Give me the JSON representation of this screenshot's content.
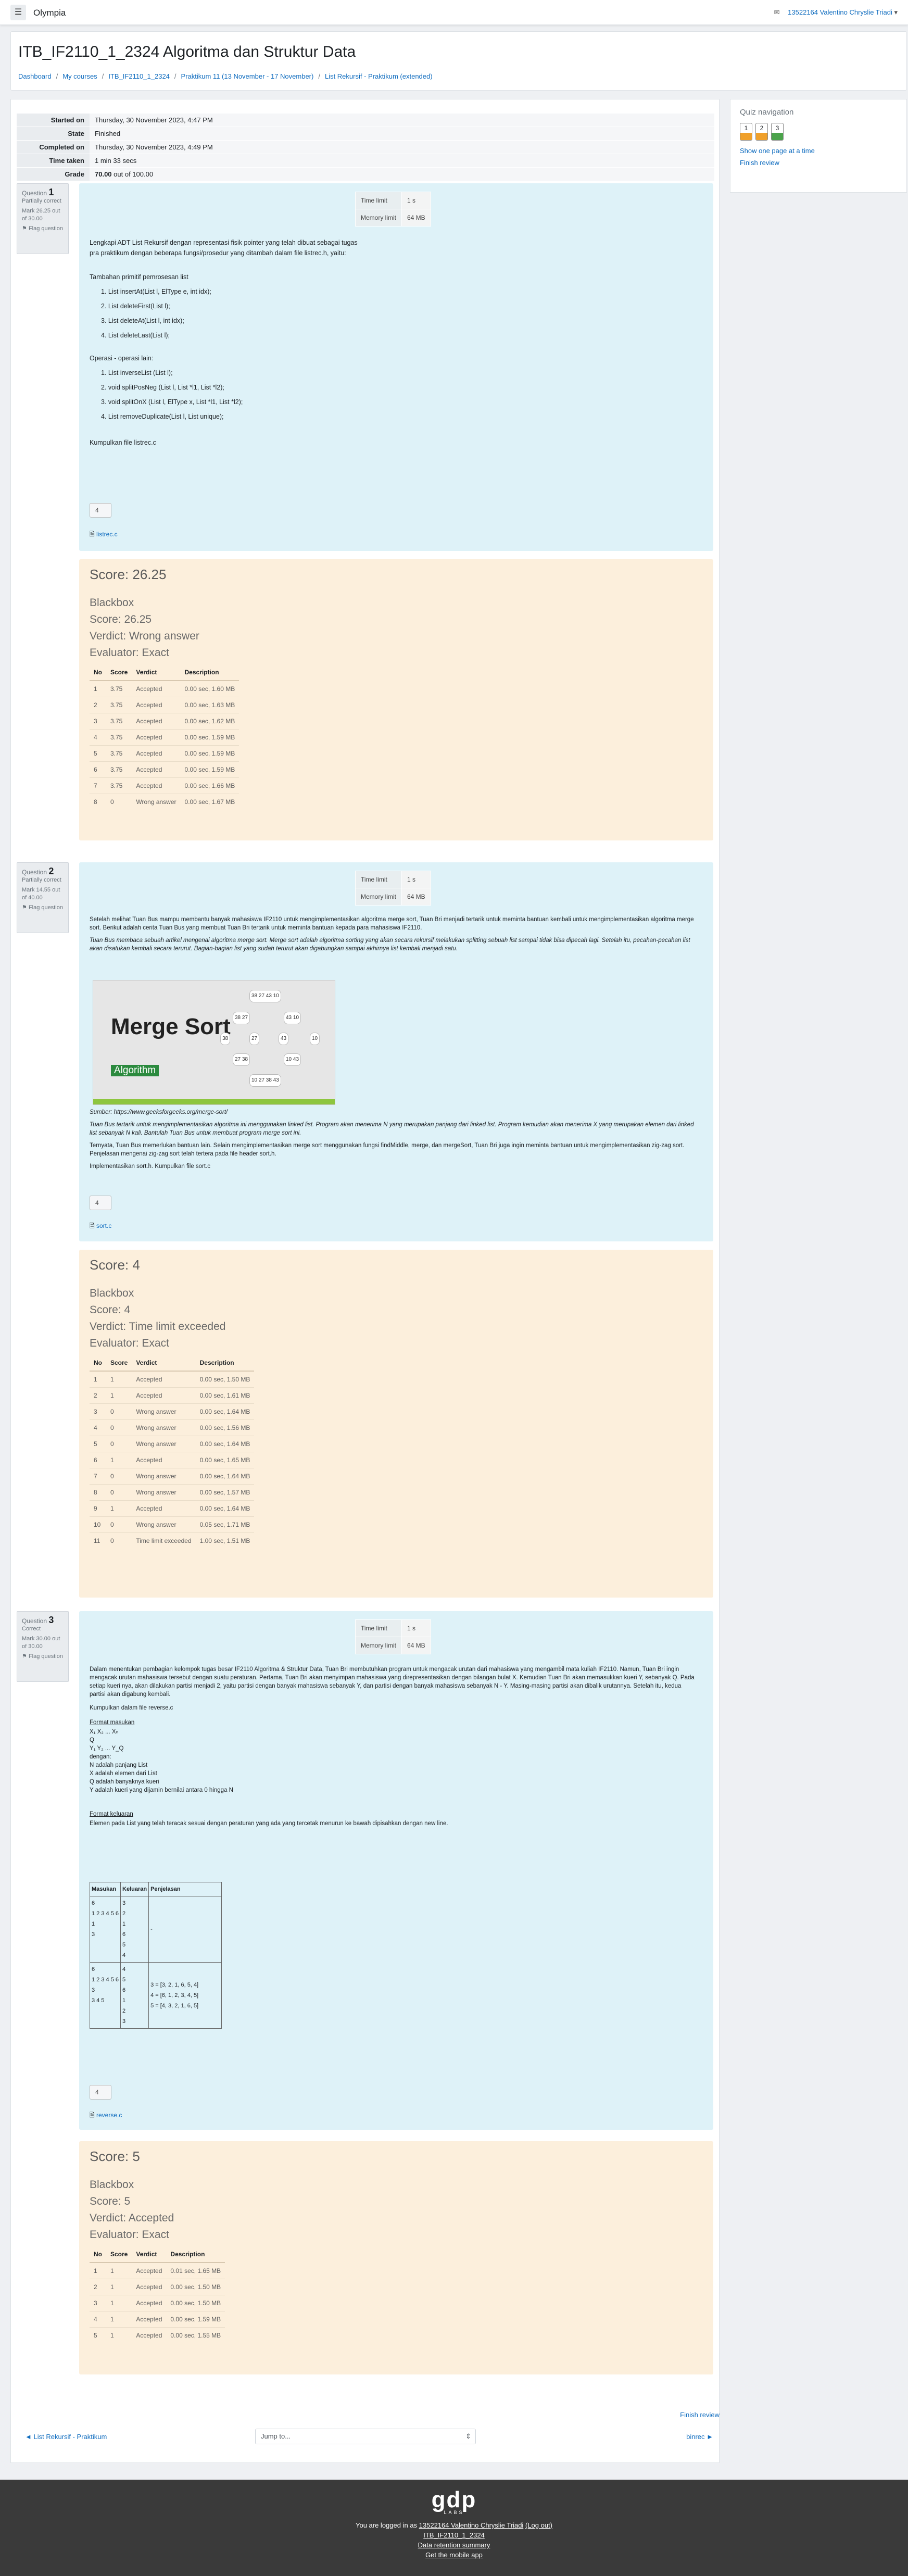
{
  "nav": {
    "brand": "Olympia",
    "user": "13522164 Valentino Chryslie Triadi"
  },
  "header": {
    "title": "ITB_IF2110_1_2324 Algoritma dan Struktur Data",
    "breadcrumb": [
      "Dashboard",
      "My courses",
      "ITB_IF2110_1_2324",
      "Praktikum 11 (13 November - 17 November)",
      "List Rekursif - Praktikum (extended)"
    ]
  },
  "summary": [
    {
      "label": "Started on",
      "value": "Thursday, 30 November 2023, 4:47 PM"
    },
    {
      "label": "State",
      "value": "Finished"
    },
    {
      "label": "Completed on",
      "value": "Thursday, 30 November 2023, 4:49 PM"
    },
    {
      "label": "Time taken",
      "value": "1 min 33 secs"
    },
    {
      "label": "Grade",
      "bold": "70.00",
      "value": " out of 100.00"
    }
  ],
  "quiznav": {
    "title": "Quiz navigation",
    "buttons": [
      "1",
      "2",
      "3"
    ],
    "show_one_page": "Show one page at a time",
    "finish_review": "Finish review"
  },
  "limits": {
    "time_label": "Time limit",
    "time_val": "1 s",
    "mem_label": "Memory limit",
    "mem_val": "64 MB"
  },
  "q1": {
    "info": {
      "prefix": "Question",
      "num": "1",
      "state": "Partially correct",
      "marks": "Mark 26.25 out of 30.00",
      "flag": "Flag question"
    },
    "intro": [
      "Lengkapi ADT List Rekursif dengan representasi fisik pointer yang telah dibuat sebagai tugas",
      "pra praktikum dengan beberapa fungsi/prosedur yang ditambah dalam file listrec.h, yaitu:"
    ],
    "added_title": "Tambahan primitif pemrosesan list",
    "added": [
      "1. List insertAt(List l, ElType e, int idx);",
      "2. List deleteFirst(List l);",
      "3. List deleteAt(List l, int idx);",
      "4. List deleteLast(List l);"
    ],
    "ops_title": "Operasi - operasi lain:",
    "ops": [
      "1. List inverseList (List l);",
      "2. void splitPosNeg (List l, List *l1, List *l2);",
      "3. void splitOnX (List l, ElType x, List *l1, List *l2);",
      "4. List removeDuplicate(List l, List unique);"
    ],
    "submit": "Kumpulkan file listrec.c",
    "answer": "4",
    "file": "listrec.c"
  },
  "fb1": {
    "score_big": "Score: 26.25",
    "name": "Blackbox",
    "score": "Score: 26.25",
    "verdict": "Verdict: Wrong answer",
    "evaluator": "Evaluator: Exact",
    "headers": [
      "No",
      "Score",
      "Verdict",
      "Description"
    ],
    "rows": [
      [
        "1",
        "3.75",
        "Accepted",
        "0.00 sec, 1.60 MB"
      ],
      [
        "2",
        "3.75",
        "Accepted",
        "0.00 sec, 1.63 MB"
      ],
      [
        "3",
        "3.75",
        "Accepted",
        "0.00 sec, 1.62 MB"
      ],
      [
        "4",
        "3.75",
        "Accepted",
        "0.00 sec, 1.59 MB"
      ],
      [
        "5",
        "3.75",
        "Accepted",
        "0.00 sec, 1.59 MB"
      ],
      [
        "6",
        "3.75",
        "Accepted",
        "0.00 sec, 1.59 MB"
      ],
      [
        "7",
        "3.75",
        "Accepted",
        "0.00 sec, 1.66 MB"
      ],
      [
        "8",
        "0",
        "Wrong answer",
        "0.00 sec, 1.67 MB"
      ]
    ]
  },
  "q2": {
    "info": {
      "prefix": "Question",
      "num": "2",
      "state": "Partially correct",
      "marks": "Mark 14.55 out of 40.00",
      "flag": "Flag question"
    },
    "p1": "Setelah melihat Tuan Bus mampu membantu banyak mahasiswa IF2110 untuk mengimplementasikan algoritma merge sort, Tuan Bri menjadi tertarik untuk meminta bantuan kembali untuk mengimplementasikan algoritma merge sort. Berikut adalah cerita Tuan Bus yang membuat Tuan Bri tertarik untuk meminta bantuan kepada para mahasiswa IF2110.",
    "p2": "Tuan Bus membaca sebuah artikel mengenai algoritma merge sort. Merge sort adalah algoritma sorting yang akan secara rekursif melakukan splitting sebuah list sampai tidak bisa dipecah lagi. Setelah itu, pecahan-pecahan list akan disatukan kembali secara terurut. Bagian-bagian list yang sudah terurut akan digabungkan sampai akhirnya list kembali menjadi satu.",
    "img_title": "Merge Sort",
    "img_tag": "Algorithm",
    "source": "Sumber: https://www.geeksforgeeks.org/merge-sort/",
    "p3": "Tuan Bus tertarik untuk mengimplementasikan algoritma ini menggunakan linked list. Program akan menerima N yang merupakan panjang dari linked list. Program kemudian akan menerima X yang merupakan elemen dari linked list sebanyak N kali. Bantulah Tuan Bus untuk membuat program merge sort ini.",
    "p4": "Ternyata, Tuan Bus memerlukan bantuan lain. Selain mengimplementasikan merge sort menggunakan fungsi findMiddle, merge, dan mergeSort, Tuan Bri juga ingin meminta bantuan untuk mengimplementasikan zig-zag sort. Penjelasan mengenai zig-zag sort telah tertera pada file header sort.h.",
    "submit": "Implementasikan sort.h. Kumpulkan file sort.c",
    "answer": "4",
    "file": "sort.c"
  },
  "fb2": {
    "score_big": "Score: 4",
    "name": "Blackbox",
    "score": "Score: 4",
    "verdict": "Verdict: Time limit exceeded",
    "evaluator": "Evaluator: Exact",
    "headers": [
      "No",
      "Score",
      "Verdict",
      "Description"
    ],
    "rows": [
      [
        "1",
        "1",
        "Accepted",
        "0.00 sec, 1.50 MB"
      ],
      [
        "2",
        "1",
        "Accepted",
        "0.00 sec, 1.61 MB"
      ],
      [
        "3",
        "0",
        "Wrong answer",
        "0.00 sec, 1.64 MB"
      ],
      [
        "4",
        "0",
        "Wrong answer",
        "0.00 sec, 1.56 MB"
      ],
      [
        "5",
        "0",
        "Wrong answer",
        "0.00 sec, 1.64 MB"
      ],
      [
        "6",
        "1",
        "Accepted",
        "0.00 sec, 1.65 MB"
      ],
      [
        "7",
        "0",
        "Wrong answer",
        "0.00 sec, 1.64 MB"
      ],
      [
        "8",
        "0",
        "Wrong answer",
        "0.00 sec, 1.57 MB"
      ],
      [
        "9",
        "1",
        "Accepted",
        "0.00 sec, 1.64 MB"
      ],
      [
        "10",
        "0",
        "Wrong answer",
        "0.05 sec, 1.71 MB"
      ],
      [
        "11",
        "0",
        "Time limit exceeded",
        "1.00 sec, 1.51 MB"
      ]
    ]
  },
  "q3": {
    "info": {
      "prefix": "Question",
      "num": "3",
      "state": "Correct",
      "marks": "Mark 30.00 out of 30.00",
      "flag": "Flag question"
    },
    "p1": "Dalam menentukan pembagian kelompok tugas besar IF2110 Algoritma & Struktur Data, Tuan Bri membutuhkan program untuk mengacak urutan dari mahasiswa yang mengambil mata kuliah IF2110. Namun, Tuan Bri ingin mengacak urutan mahasiswa tersebut dengan suatu peraturan. Pertama, Tuan Bri akan menyimpan mahasiswa yang direpresentasikan dengan bilangan bulat X. Kemudian Tuan Bri akan memasukkan kueri Y, sebanyak Q. Pada setiap kueri nya, akan dilakukan partisi menjadi 2, yaitu partisi dengan banyak mahasiswa sebanyak Y, dan partisi dengan banyak mahasiswa sebanyak N - Y. Masing-masing partisi akan dibalik urutannya. Setelah itu, kedua partisi akan digabung kembali.",
    "submit": "Kumpulkan dalam file reverse.c",
    "input_title": "Format masukan",
    "input_lines": [
      "X₁ X₂ ... Xₙ",
      "Q",
      "Y₁ Y₂ ... Y_Q",
      "dengan:",
      "N adalah panjang List",
      "X adalah elemen dari List",
      "Q adalah banyaknya kueri",
      "Y adalah kueri yang dijamin bernilai antara 0 hingga N"
    ],
    "output_title": "Format keluaran",
    "output_text": "Elemen pada List yang telah teracak sesuai dengan peraturan yang ada yang tercetak menurun ke bawah dipisahkan dengan new line.",
    "io_headers": [
      "Masukan",
      "Keluaran",
      "Penjelasan"
    ],
    "io_rows": [
      {
        "in": [
          "6",
          "1 2 3 4 5 6",
          "1",
          "3"
        ],
        "out": [
          "3",
          "2",
          "1",
          "6",
          "5",
          "4"
        ],
        "exp": [
          "-"
        ]
      },
      {
        "in": [
          "6",
          "1 2 3 4 5 6",
          "3",
          "3 4 5"
        ],
        "out": [
          "4",
          "5",
          "6",
          "1",
          "2",
          "3"
        ],
        "exp": [
          "3 = [3, 2, 1, 6, 5, 4]",
          "4 = [6, 1, 2, 3, 4, 5]",
          "5 = [4, 3, 2, 1, 6, 5]"
        ]
      }
    ],
    "answer": "4",
    "file": "reverse.c"
  },
  "fb3": {
    "score_big": "Score: 5",
    "name": "Blackbox",
    "score": "Score: 5",
    "verdict": "Verdict: Accepted",
    "evaluator": "Evaluator: Exact",
    "headers": [
      "No",
      "Score",
      "Verdict",
      "Description"
    ],
    "rows": [
      [
        "1",
        "1",
        "Accepted",
        "0.01 sec, 1.65 MB"
      ],
      [
        "2",
        "1",
        "Accepted",
        "0.00 sec, 1.50 MB"
      ],
      [
        "3",
        "1",
        "Accepted",
        "0.00 sec, 1.50 MB"
      ],
      [
        "4",
        "1",
        "Accepted",
        "0.00 sec, 1.59 MB"
      ],
      [
        "5",
        "1",
        "Accepted",
        "0.00 sec, 1.55 MB"
      ]
    ]
  },
  "bottom": {
    "finish_review": "Finish review",
    "prev": "◄ List Rekursif - Praktikum",
    "jump": "Jump to...",
    "next": "binrec ►"
  },
  "footer": {
    "logo": "gdp",
    "logo_sub": "LABS",
    "logged_prefix": "You are logged in as ",
    "user": "13522164 Valentino Chryslie Triadi",
    "logout": "(Log out)",
    "course": "ITB_IF2110_1_2324",
    "retention": "Data retention summary",
    "app": "Get the mobile app"
  }
}
